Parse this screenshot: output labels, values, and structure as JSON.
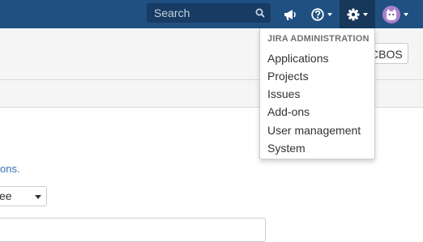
{
  "header": {
    "search": {
      "placeholder": "Search"
    },
    "icons": [
      "search-icon",
      "megaphone-icon",
      "help-icon",
      "gear-icon",
      "avatar"
    ],
    "brand_color": "#205081"
  },
  "admin_menu": {
    "heading": "JIRA ADMINISTRATION",
    "items": [
      {
        "label": "Applications"
      },
      {
        "label": "Projects"
      },
      {
        "label": "Issues"
      },
      {
        "label": "Add-ons"
      },
      {
        "label": "User management"
      },
      {
        "label": "System"
      }
    ]
  },
  "page": {
    "button_label": "CBOS",
    "link_text": "ons.",
    "select_value": "ee"
  }
}
